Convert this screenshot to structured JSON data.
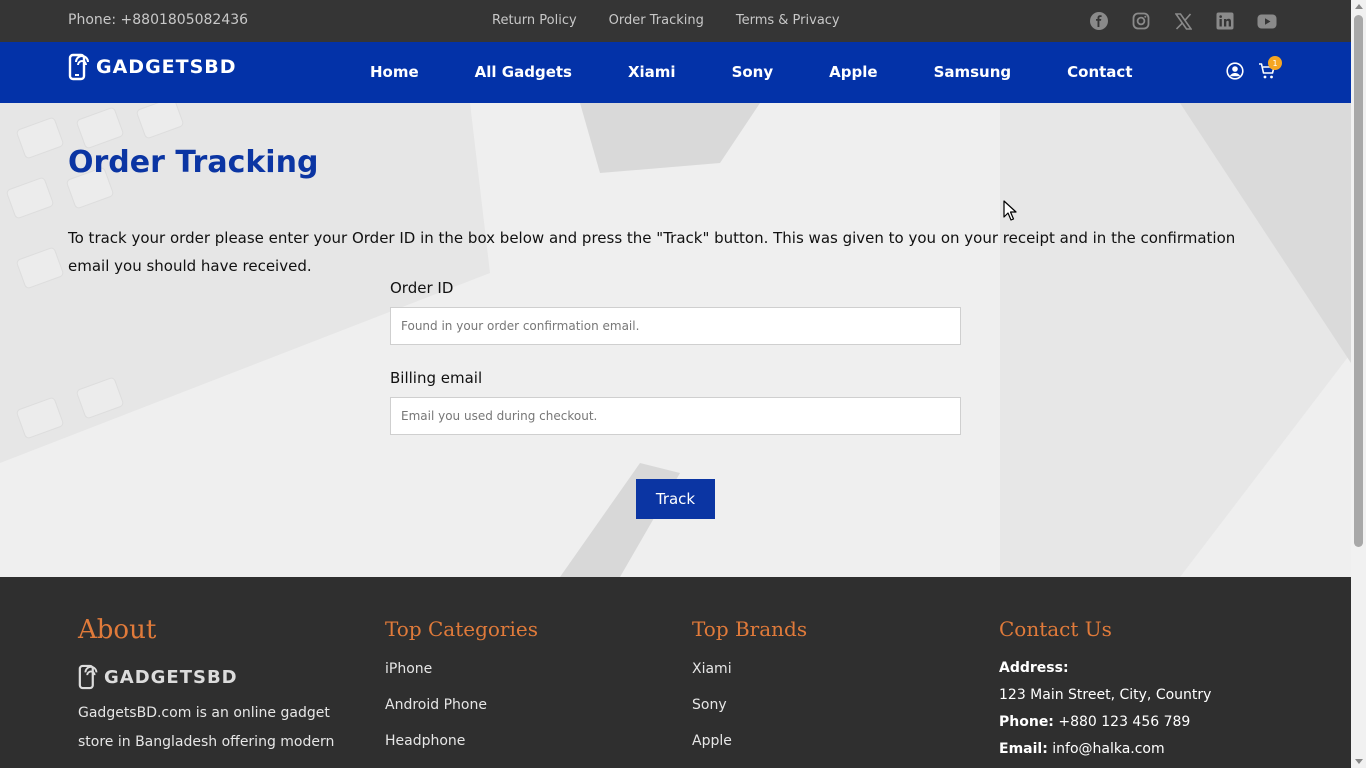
{
  "topbar": {
    "phone": "Phone: +8801805082436",
    "links": [
      "Return Policy",
      "Order Tracking",
      "Terms & Privacy"
    ],
    "social_icons": [
      "facebook-icon",
      "instagram-icon",
      "x-icon",
      "linkedin-icon",
      "youtube-icon"
    ]
  },
  "nav": {
    "logo_text": "GADGETSBD",
    "menu": [
      "Home",
      "All Gadgets",
      "Xiami",
      "Sony",
      "Apple",
      "Samsung",
      "Contact"
    ],
    "cart_count": "1"
  },
  "main": {
    "title": "Order Tracking",
    "description": "To track your order please enter your Order ID in the box below and press the \"Track\" button. This was given to you on your receipt and in the confirmation email you should have received.",
    "order_id_label": "Order ID",
    "order_id_placeholder": "Found in your order confirmation email.",
    "email_label": "Billing email",
    "email_placeholder": "Email you used during checkout.",
    "track_label": "Track"
  },
  "footer": {
    "about": {
      "heading": "About",
      "logo_text": "GADGETSBD",
      "text": "GadgetsBD.com is an online gadget store in Bangladesh offering modern"
    },
    "categories": {
      "heading": "Top Categories",
      "items": [
        "iPhone",
        "Android Phone",
        "Headphone"
      ]
    },
    "brands": {
      "heading": "Top Brands",
      "items": [
        "Xiami",
        "Sony",
        "Apple"
      ]
    },
    "contact": {
      "heading": "Contact Us",
      "address_label": "Address:",
      "address": "123 Main Street, City, Country",
      "phone_label": "Phone:",
      "phone": "+880 123 456 789",
      "email_label": "Email:",
      "email": "info@halka.com"
    }
  },
  "colors": {
    "nav_blue": "#0332a8",
    "title_blue": "#0b35a3",
    "accent_orange": "#e07a3a",
    "badge_orange": "#f5a623"
  }
}
